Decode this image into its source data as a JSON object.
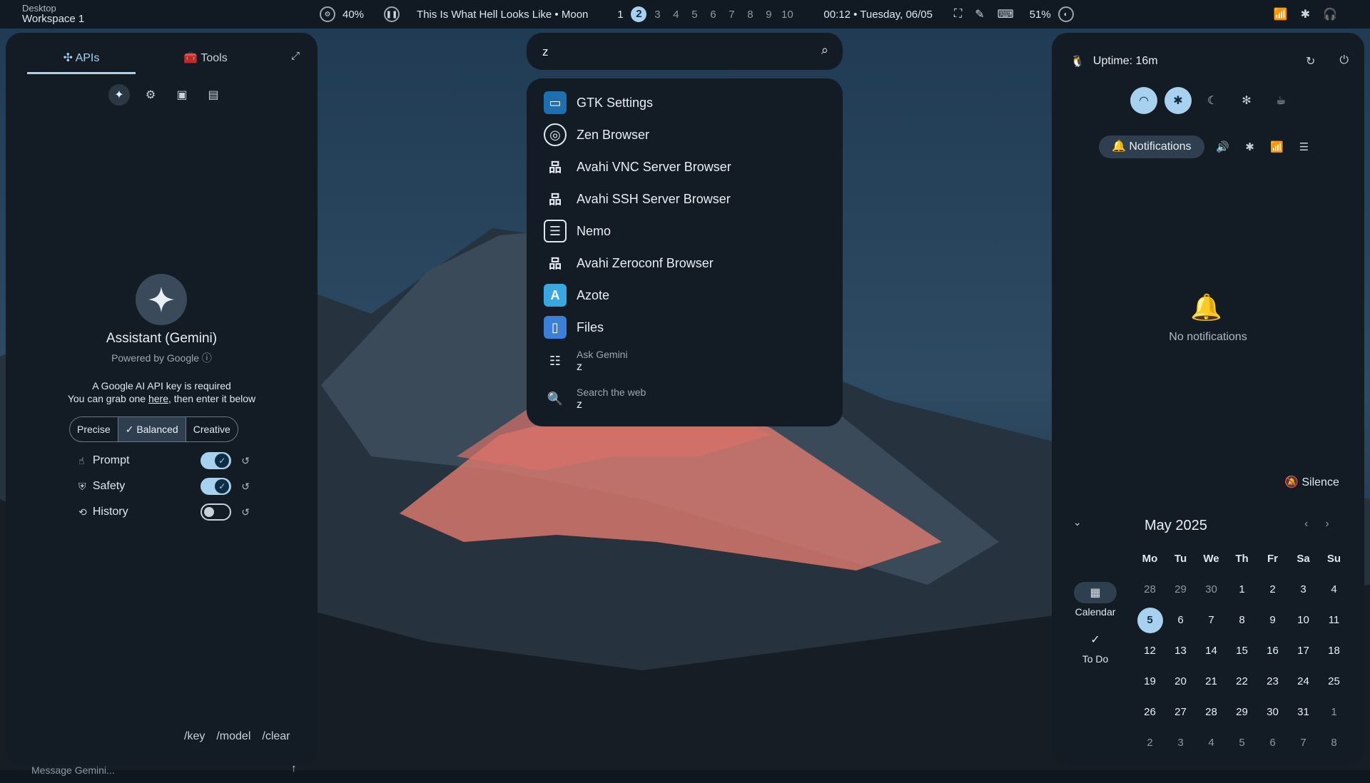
{
  "topbar": {
    "desktop_label": "Desktop",
    "workspace_label": "Workspace 1",
    "cpu_percent": "40%",
    "media_title": "This Is What Hell Looks Like • Moon",
    "workspaces": [
      "1",
      "2",
      "3",
      "4",
      "5",
      "6",
      "7",
      "8",
      "9",
      "10"
    ],
    "active_workspace": "2",
    "clock": "00:12 • Tuesday, 06/05",
    "battery": "51%"
  },
  "ai_panel": {
    "tabs": [
      {
        "label": "APIs"
      },
      {
        "label": "Tools"
      }
    ],
    "assistant_title": "Assistant (Gemini)",
    "powered_by": "Powered by Google",
    "api_note_line1": "A Google AI API key is required",
    "api_note_pre": "You can grab one ",
    "api_note_link": "here",
    "api_note_post": ", then enter it below",
    "modes": [
      "Precise",
      "Balanced",
      "Creative"
    ],
    "selected_mode": "Balanced",
    "options": [
      {
        "label": "Prompt",
        "enabled": true
      },
      {
        "label": "Safety",
        "enabled": true
      },
      {
        "label": "History",
        "enabled": false
      }
    ],
    "commands": [
      "/key",
      "/model",
      "/clear"
    ],
    "message_placeholder": "Message Gemini..."
  },
  "launcher": {
    "query": "z",
    "results": [
      {
        "label": "GTK Settings",
        "icon": "gtk-settings-icon"
      },
      {
        "label": "Zen Browser",
        "icon": "zen-browser-icon"
      },
      {
        "label": "Avahi VNC Server Browser",
        "icon": "network-icon"
      },
      {
        "label": "Avahi SSH Server Browser",
        "icon": "network-icon"
      },
      {
        "label": "Nemo",
        "icon": "file-manager-icon"
      },
      {
        "label": "Avahi Zeroconf Browser",
        "icon": "network-icon"
      },
      {
        "label": "Azote",
        "icon": "azote-icon"
      },
      {
        "label": "Files",
        "icon": "files-icon"
      }
    ],
    "ask_gemini_label": "Ask Gemini",
    "ask_gemini_query": "z",
    "search_web_label": "Search the web",
    "search_web_query": "z"
  },
  "sidebar": {
    "uptime": "Uptime: 16m",
    "notifications_tab": "Notifications",
    "no_notifications": "No notifications",
    "silence_label": "Silence",
    "calendar": {
      "title": "May 2025",
      "weekdays": [
        "Mo",
        "Tu",
        "We",
        "Th",
        "Fr",
        "Sa",
        "Su"
      ],
      "days": [
        "28",
        "29",
        "30",
        "1",
        "2",
        "3",
        "4",
        "5",
        "6",
        "7",
        "8",
        "9",
        "10",
        "11",
        "12",
        "13",
        "14",
        "15",
        "16",
        "17",
        "18",
        "19",
        "20",
        "21",
        "22",
        "23",
        "24",
        "25",
        "26",
        "27",
        "28",
        "29",
        "30",
        "31",
        "1",
        "2",
        "3",
        "4",
        "5",
        "6",
        "7",
        "8"
      ],
      "today": "5",
      "calendar_label": "Calendar",
      "todo_label": "To Do"
    }
  },
  "colors": {
    "accent": "#a8d0ef",
    "panel": "#131c25",
    "topbar": "#111a22"
  }
}
